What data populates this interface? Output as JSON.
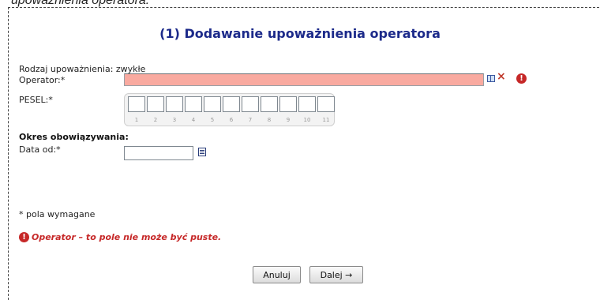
{
  "header": {
    "caption": "upoważnienia operatora."
  },
  "form": {
    "title": "(1) Dodawanie upoważnienia operatora",
    "authorization_type_label": "Rodzaj upoważnienia:",
    "authorization_type_value": "zwykłe",
    "operator_label": "Operator:*",
    "operator_value": "",
    "pesel_label": "PESEL:*",
    "pesel_positions": [
      "1",
      "2",
      "3",
      "4",
      "5",
      "6",
      "7",
      "8",
      "9",
      "10",
      "11"
    ],
    "validity_section": "Okres obowiązywania:",
    "date_from_label": "Data od:*",
    "date_from_value": "",
    "required_note": "* pola wymagane",
    "error_message": "Operator – to pole nie może być puste."
  },
  "icons": {
    "operator_lookup": "book-icon",
    "operator_clear": "clear-x-icon",
    "operator_error": "error-alert-icon",
    "date_picker": "calendar-icon"
  },
  "colors": {
    "title": "#1c2a8a",
    "invalid_field": "#f9aaa0",
    "error": "#c62828"
  },
  "buttons": {
    "cancel": "Anuluj",
    "next": "Dalej →"
  }
}
